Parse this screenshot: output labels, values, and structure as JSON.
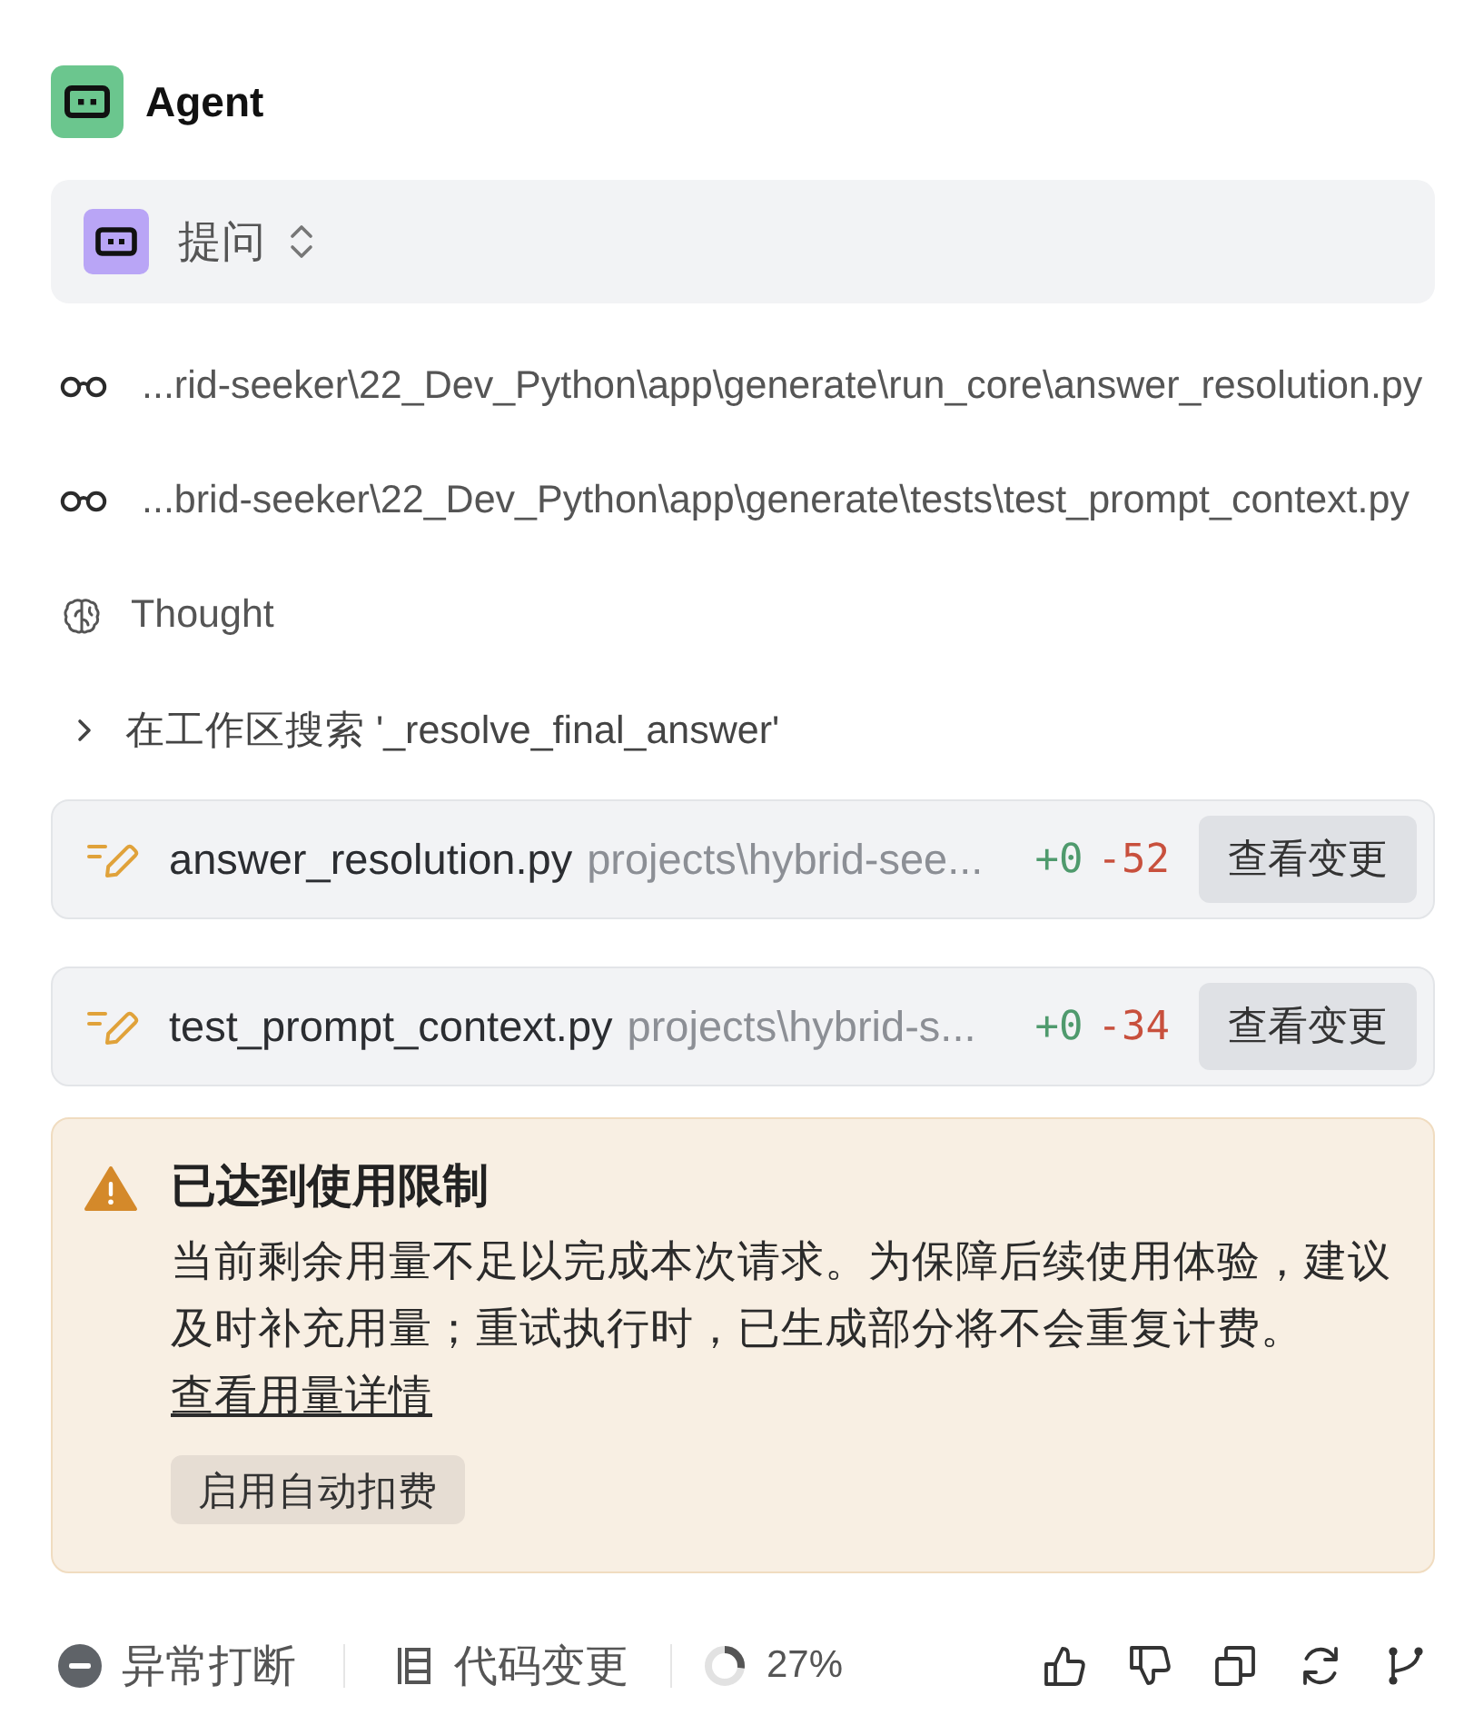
{
  "header": {
    "title": "Agent"
  },
  "mode_selector": {
    "label": "提问"
  },
  "steps": [
    {
      "kind": "read",
      "text": "...rid-seeker\\22_Dev_Python\\app\\generate\\run_core\\answer_resolution.py"
    },
    {
      "kind": "read",
      "text": "...brid-seeker\\22_Dev_Python\\app\\generate\\tests\\test_prompt_context.py"
    },
    {
      "kind": "thought",
      "text": "Thought"
    },
    {
      "kind": "search",
      "text": "在工作区搜索 '_resolve_final_answer'",
      "expanded": false
    }
  ],
  "file_changes": [
    {
      "file": "answer_resolution.py",
      "path": "projects\\hybrid-see...",
      "added": "+0",
      "removed": "-52",
      "button": "查看变更"
    },
    {
      "file": "test_prompt_context.py",
      "path": "projects\\hybrid-s...",
      "added": "+0",
      "removed": "-34",
      "button": "查看变更"
    }
  ],
  "alert": {
    "title": "已达到使用限制",
    "message": "当前剩余用量不足以完成本次请求。为保障后续使用体验，建议及时补充用量；重试执行时，已生成部分将不会重复计费。",
    "link": "查看用量详情",
    "button": "启用自动扣费"
  },
  "footer": {
    "status": {
      "label": "异常打断"
    },
    "code_changes": {
      "label": "代码变更"
    },
    "progress": {
      "label": "27%",
      "level": 0.27
    }
  }
}
